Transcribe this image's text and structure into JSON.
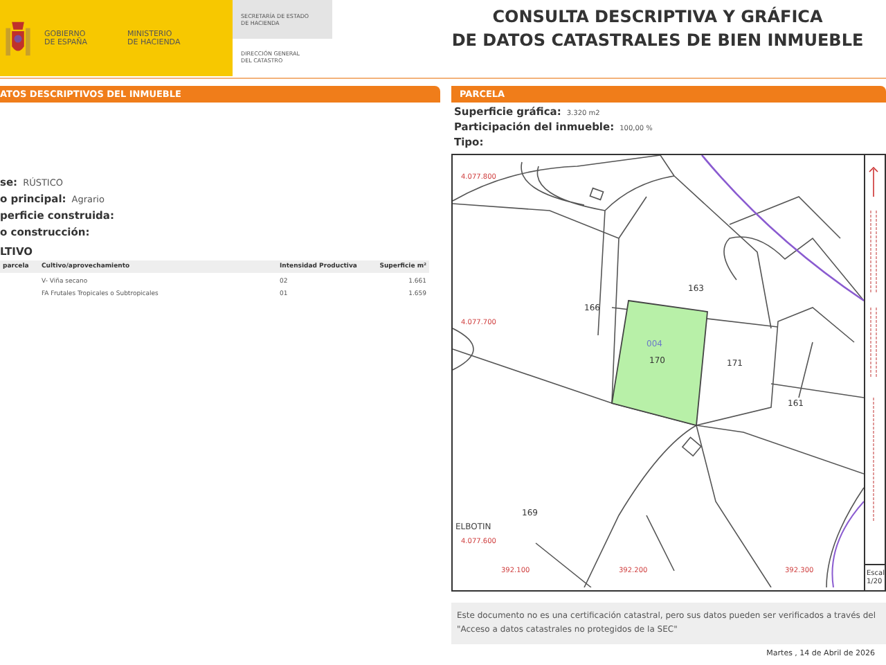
{
  "header": {
    "government": [
      "GOBIERNO",
      "DE ESPAÑA"
    ],
    "ministry": [
      "MINISTERIO",
      "DE HACIENDA"
    ],
    "secretariat": [
      "SECRETARÍA DE ESTADO",
      "DE HACIENDA"
    ],
    "directorate": [
      "DIRECCIÓN GENERAL",
      "DEL CATASTRO"
    ],
    "title": [
      "CONSULTA DESCRIPTIVA Y GRÁFICA",
      "DE DATOS CATASTRALES DE BIEN INMUEBLE"
    ]
  },
  "left": {
    "heading": "ATOS DESCRIPTIVOS DEL INMUEBLE",
    "fields": [
      {
        "label": "se:",
        "value": "RÚSTICO"
      },
      {
        "label": "o principal:",
        "value": "Agrario"
      },
      {
        "label": "perficie construida:"
      },
      {
        "label": "o construcción:"
      }
    ],
    "section_title": "LTIVO",
    "table": {
      "columns": [
        "parcela",
        "Cultivo/aprovechamiento",
        "Intensidad Productiva",
        "Superficie m²"
      ],
      "rows": [
        [
          "",
          "V- Viña secano",
          "02",
          "1.661"
        ],
        [
          "",
          "FA Frutales Tropicales o Subtropicales",
          "01",
          "1.659"
        ]
      ]
    }
  },
  "right": {
    "heading": "PARCELA",
    "fields": [
      {
        "label": "Superficie gráfica:",
        "value": "3.320 m2"
      },
      {
        "label": "Participación del inmueble:",
        "value": "100,00 %"
      },
      {
        "label": "Tipo:"
      }
    ],
    "map": {
      "parcel_labels": [
        "163",
        "166",
        "004",
        "170",
        "171",
        "161",
        "169"
      ],
      "coord_labels": [
        "4.077.800",
        "4.077.700",
        "4.077.600",
        "392.100",
        "392.200",
        "392.300"
      ],
      "place_label": "ELBOTIN",
      "scale": [
        "Escal",
        "1/20"
      ]
    }
  },
  "note": "Este documento no es una certificación catastral, pero sus datos pueden ser verificados a través del \"Acceso a datos catastrales no protegidos de la SEC\"",
  "date": "Martes , 14 de Abril de 2026"
}
